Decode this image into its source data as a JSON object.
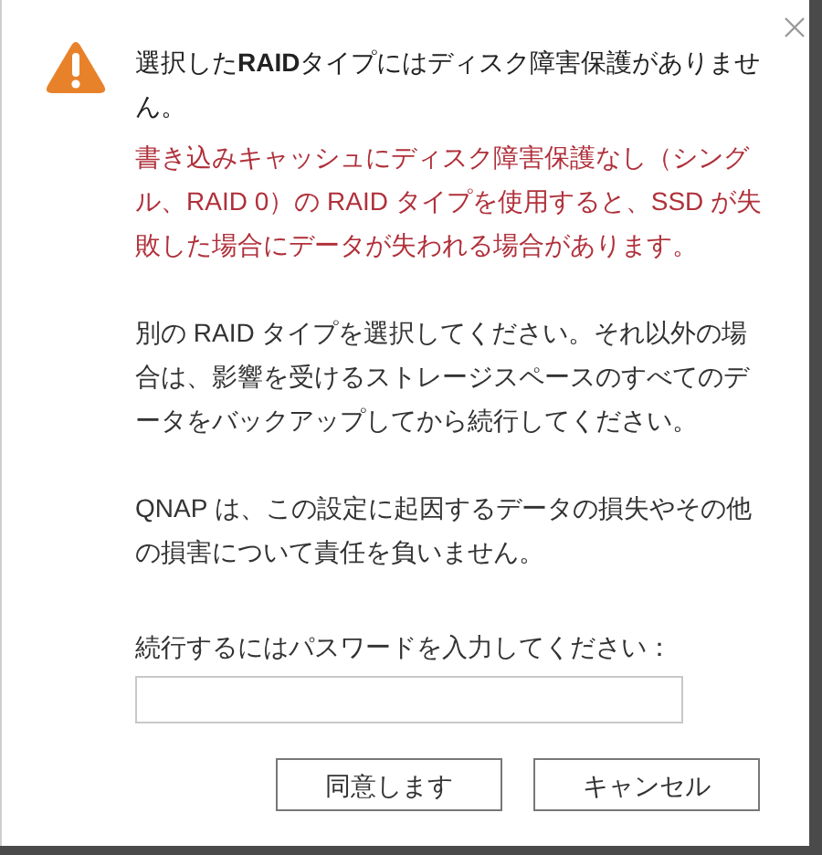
{
  "dialog": {
    "title": "選択した**RAID**タイプにはディスク障害保護がありません。",
    "warning": "書き込みキャッシュにディスク障害保護なし（シングル、RAID 0）の RAID タイプを使用すると、SSD が失敗した場合にデータが失われる場合があります。",
    "paragraphs": [
      "別の RAID タイプを選択してください。それ以外の場合は、影響を受けるストレージスペースのすべてのデータをバックアップしてから続行してください。",
      "QNAP は、この設定に起因するデータの損失やその他の損害について責任を負いません。"
    ],
    "password_label": "続行するにはパスワードを入力してください：",
    "buttons": [
      "同意します",
      "キャンセル"
    ]
  }
}
